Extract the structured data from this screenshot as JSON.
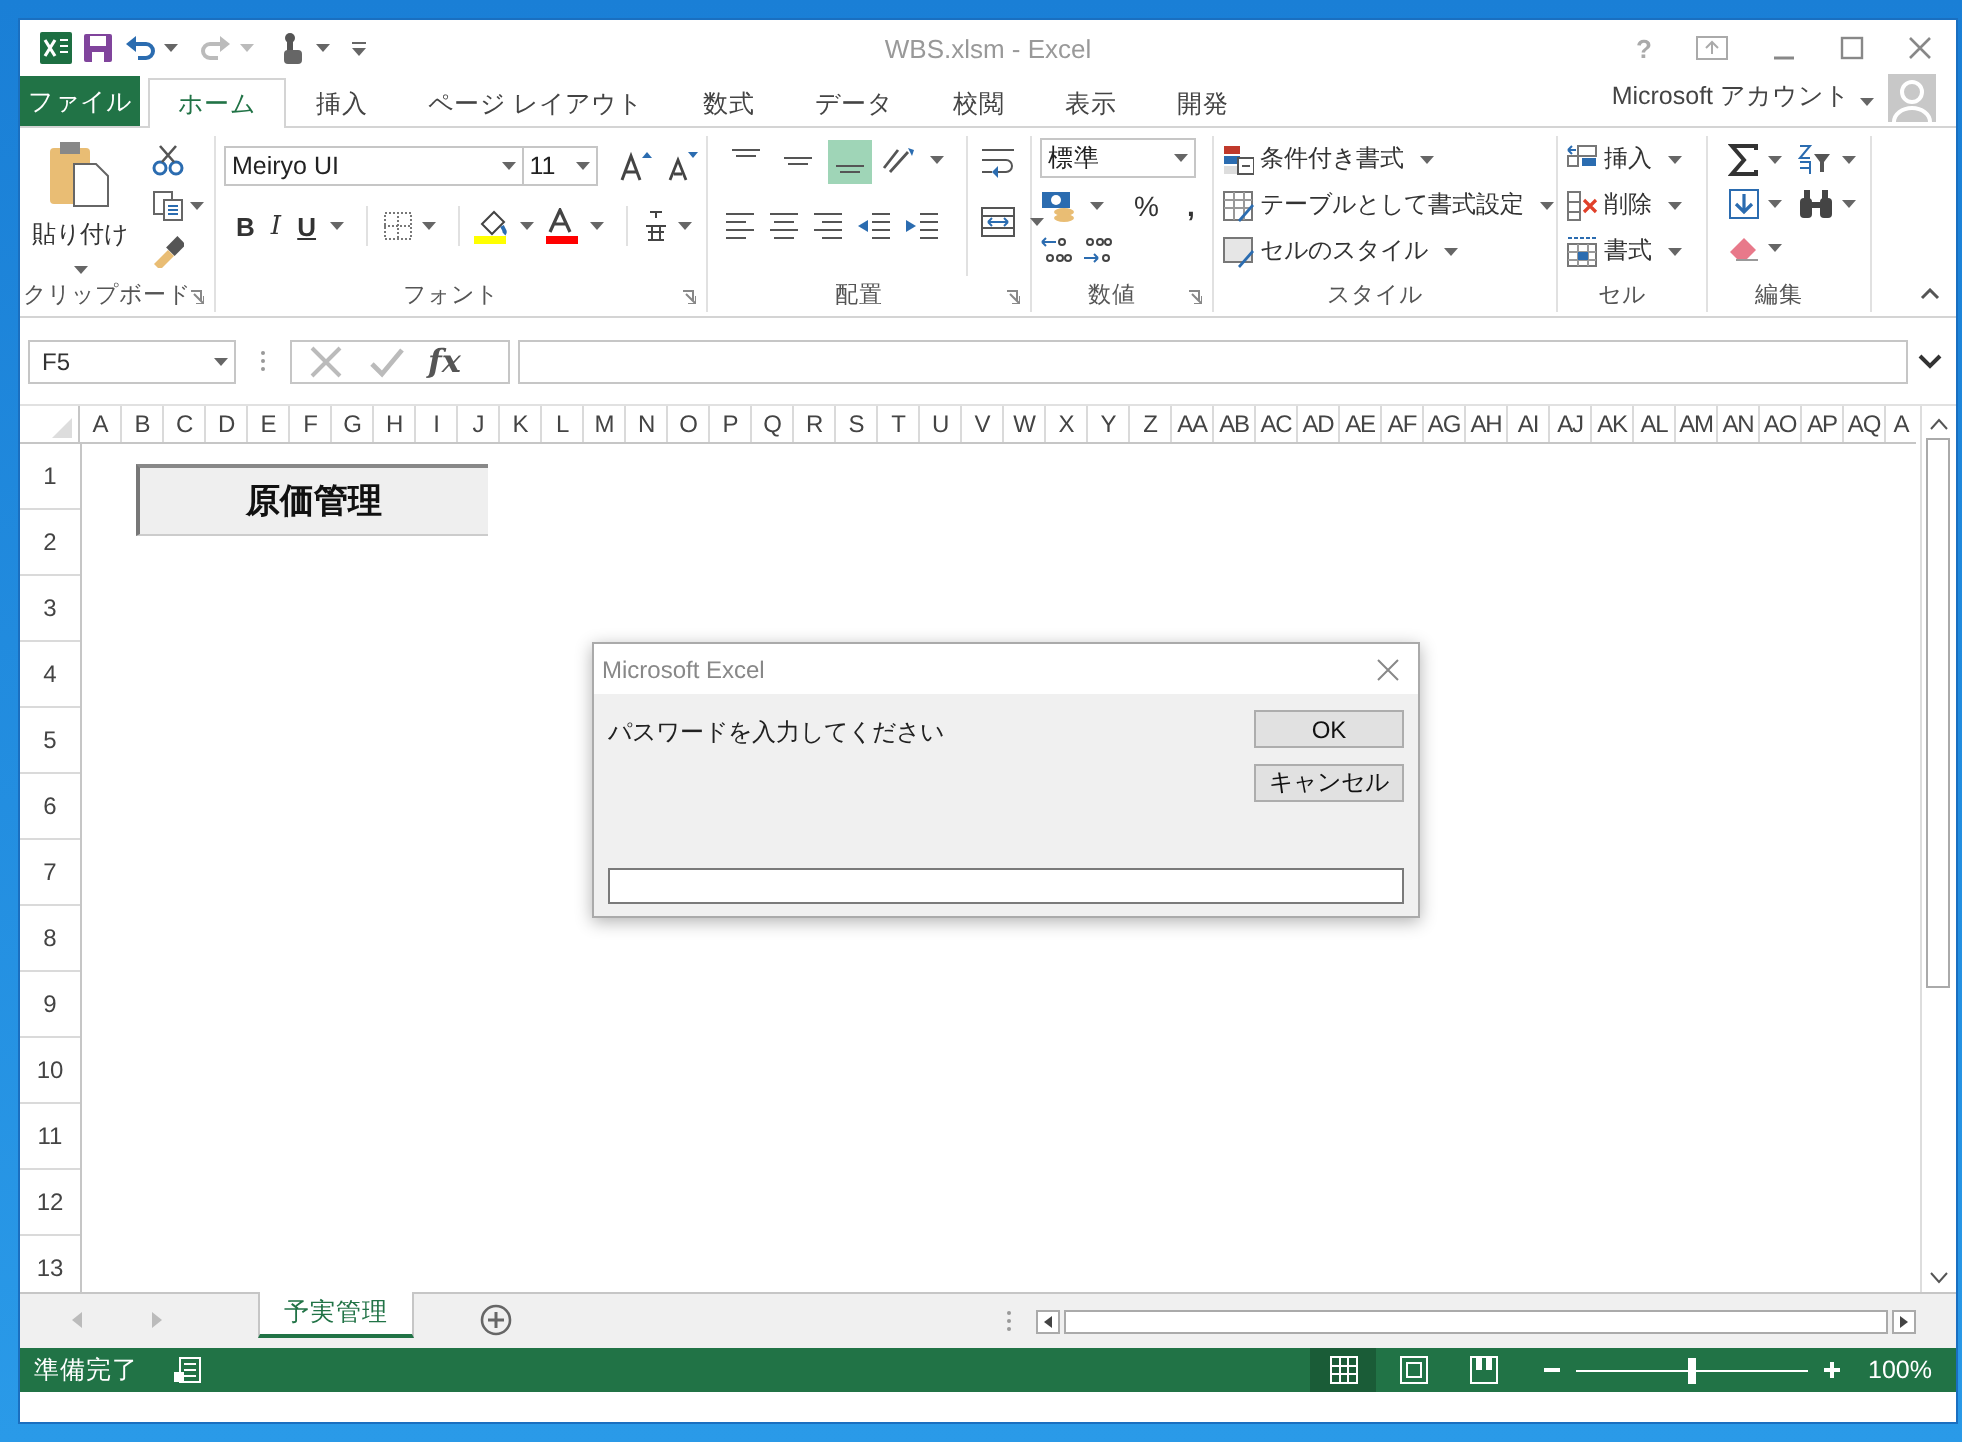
{
  "window": {
    "title": "WBS.xlsm - Excel",
    "help": "?"
  },
  "tabs": [
    {
      "label": "ファイル",
      "kind": "file",
      "selected": false
    },
    {
      "label": "ホーム",
      "kind": "tab",
      "selected": true
    },
    {
      "label": "挿入",
      "kind": "tab",
      "selected": false
    },
    {
      "label": "ページ レイアウト",
      "kind": "tab",
      "selected": false
    },
    {
      "label": "数式",
      "kind": "tab",
      "selected": false
    },
    {
      "label": "データ",
      "kind": "tab",
      "selected": false
    },
    {
      "label": "校閲",
      "kind": "tab",
      "selected": false
    },
    {
      "label": "表示",
      "kind": "tab",
      "selected": false
    },
    {
      "label": "開発",
      "kind": "tab",
      "selected": false
    }
  ],
  "account": {
    "label": "Microsoft アカウント"
  },
  "ribbon": {
    "clipboard": {
      "label": "クリップボード",
      "paste": "貼り付け"
    },
    "font": {
      "label": "フォント",
      "font_name": "Meiryo UI",
      "font_size": "11",
      "format_buttons": [
        "B",
        "I",
        "U"
      ]
    },
    "alignment": {
      "label": "配置",
      "vertical_align": [
        {
          "selected": false
        },
        {
          "selected": false
        },
        {
          "selected": true
        }
      ]
    },
    "number": {
      "label": "数値",
      "format": "標準",
      "percent": "%",
      "comma": ","
    },
    "styles": {
      "label": "スタイル",
      "commands": [
        "条件付き書式",
        "テーブルとして書式設定",
        "セルのスタイル"
      ]
    },
    "cells": {
      "label": "セル",
      "commands": [
        "挿入",
        "削除",
        "書式"
      ]
    },
    "editing": {
      "label": "編集"
    }
  },
  "formula_bar": {
    "name_box": "F5",
    "fx": "fx"
  },
  "sheet": {
    "columns": [
      "A",
      "B",
      "C",
      "D",
      "E",
      "F",
      "G",
      "H",
      "I",
      "J",
      "K",
      "L",
      "M",
      "N",
      "O",
      "P",
      "Q",
      "R",
      "S",
      "T",
      "U",
      "V",
      "W",
      "X",
      "Y",
      "Z",
      "AA",
      "AB",
      "AC",
      "AD",
      "AE",
      "AF",
      "AG",
      "AH",
      "AI",
      "AJ",
      "AK",
      "AL",
      "AM",
      "AN",
      "AO",
      "AP",
      "AQ",
      "A"
    ],
    "rows": [
      "1",
      "2",
      "3",
      "4",
      "5",
      "6",
      "7",
      "8",
      "9",
      "10",
      "11",
      "12",
      "13"
    ],
    "title_cell": "原価管理"
  },
  "sheet_tabs": [
    {
      "label": "予実管理",
      "selected": true
    }
  ],
  "status_bar": {
    "status": "準備完了",
    "views": [
      {
        "selected": true
      },
      {
        "selected": false
      },
      {
        "selected": false
      }
    ],
    "zoom": {
      "level": 0.5
    },
    "zoom_text": "100%"
  },
  "dialog": {
    "title": "Microsoft Excel",
    "message": "パスワードを入力してください",
    "buttons": [
      "OK",
      "キャンセル"
    ]
  }
}
